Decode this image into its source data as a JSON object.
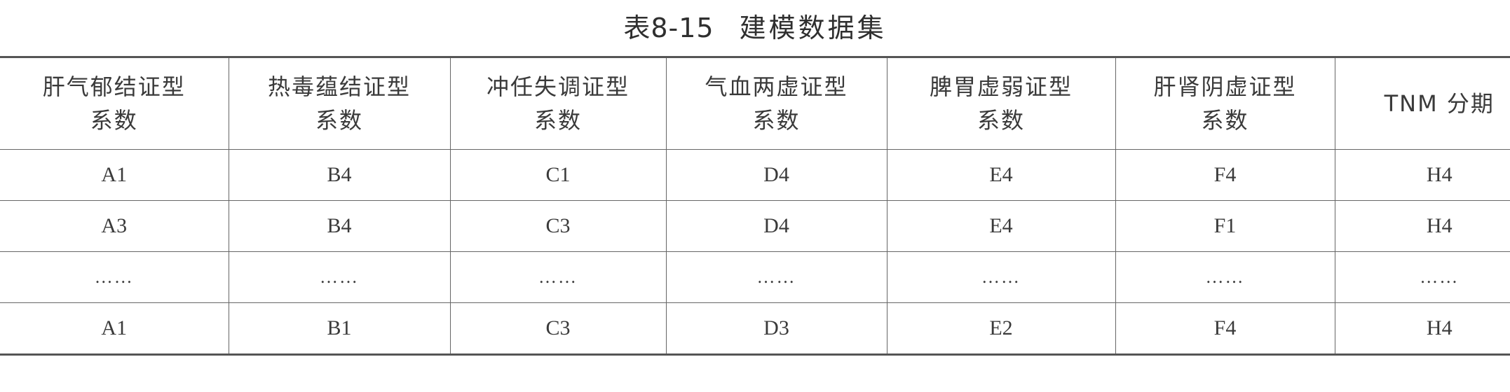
{
  "caption": {
    "number": "表8-15",
    "title": "建模数据集"
  },
  "table": {
    "headers": [
      [
        "肝气郁结证型",
        "系数"
      ],
      [
        "热毒蕴结证型",
        "系数"
      ],
      [
        "冲任失调证型",
        "系数"
      ],
      [
        "气血两虚证型",
        "系数"
      ],
      [
        "脾胃虚弱证型",
        "系数"
      ],
      [
        "肝肾阴虚证型",
        "系数"
      ],
      [
        "TNM 分期",
        ""
      ]
    ],
    "rows": [
      [
        "A1",
        "B4",
        "C1",
        "D4",
        "E4",
        "F4",
        "H4"
      ],
      [
        "A3",
        "B4",
        "C3",
        "D4",
        "E4",
        "F1",
        "H4"
      ],
      [
        "……",
        "……",
        "……",
        "……",
        "……",
        "……",
        "……"
      ],
      [
        "A1",
        "B1",
        "C3",
        "D3",
        "E2",
        "F4",
        "H4"
      ]
    ]
  }
}
